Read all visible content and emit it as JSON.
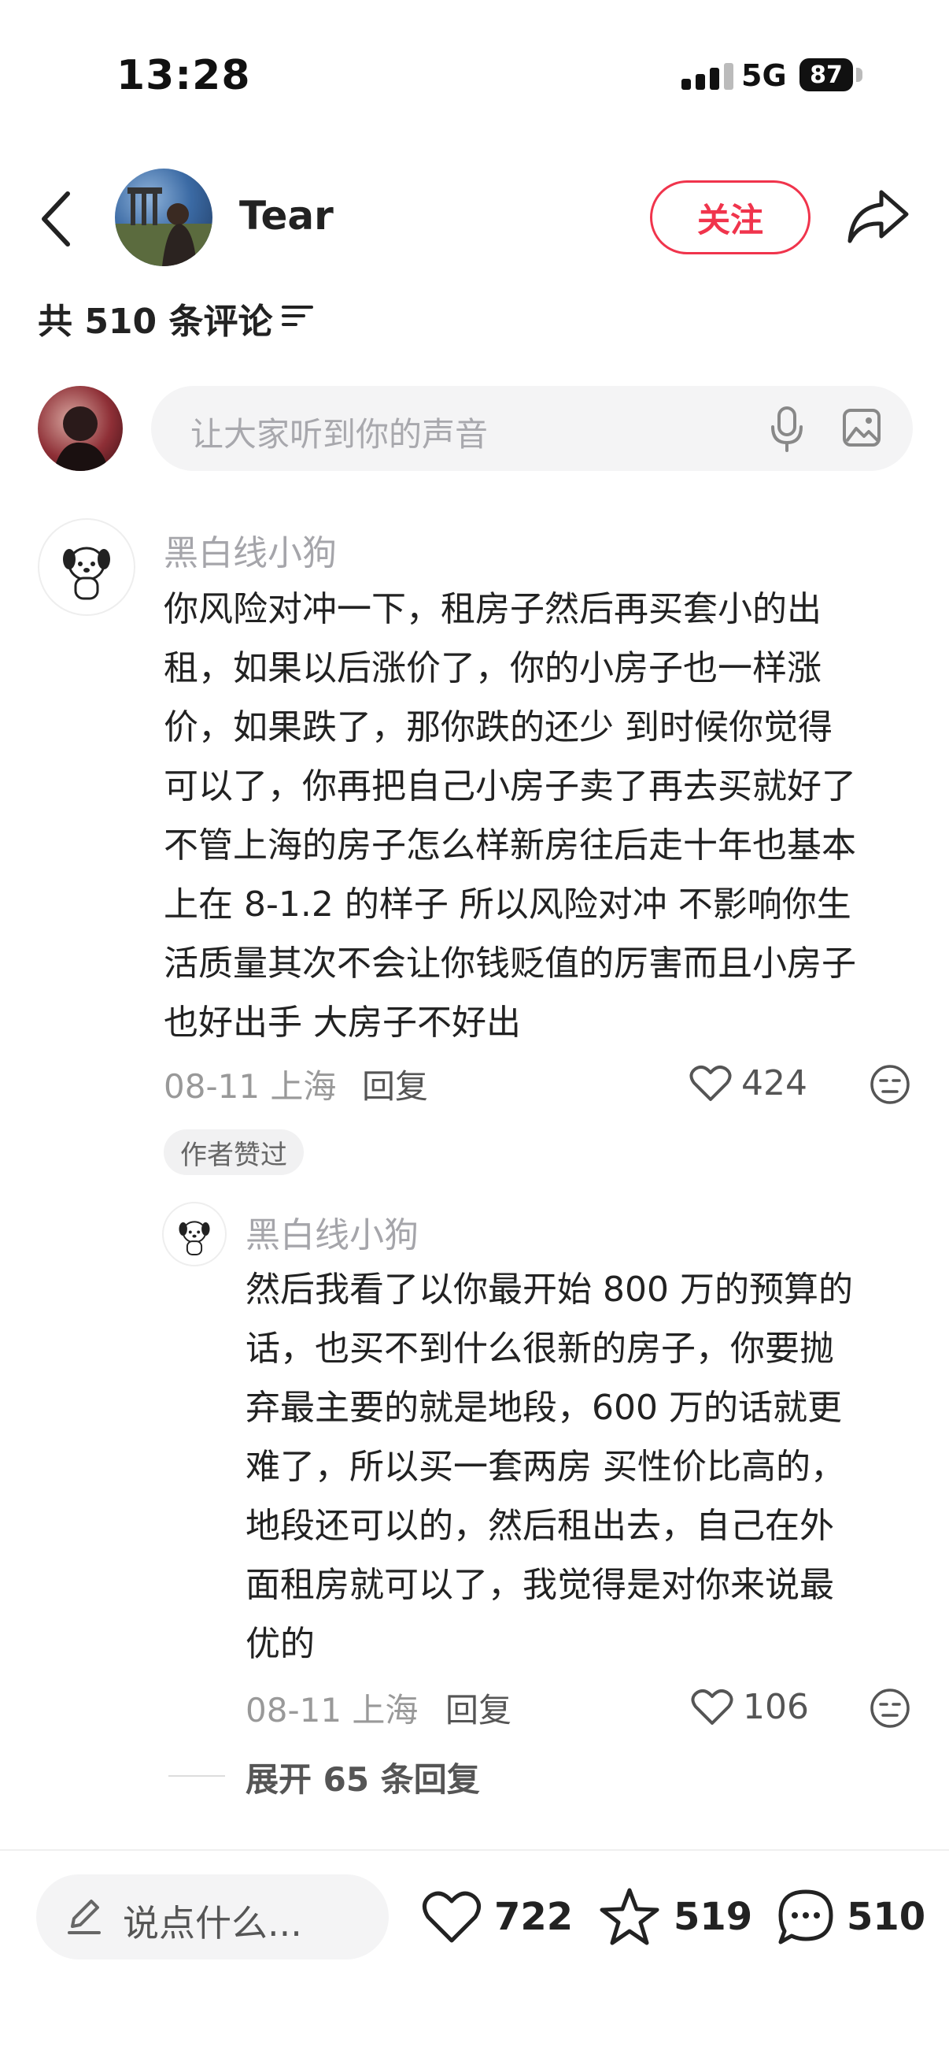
{
  "status": {
    "time": "13:28",
    "network": "5G",
    "battery": "87"
  },
  "header": {
    "back_icon": "chevron-left-icon",
    "author_name": "Tear",
    "follow_label": "关注",
    "share_icon": "share-arrow-icon"
  },
  "comments_header": {
    "count_text": "共 510 条评论",
    "sort_icon": "sort-lines-icon"
  },
  "input": {
    "placeholder": "让大家听到你的声音",
    "mic_icon": "microphone-icon",
    "image_icon": "image-icon"
  },
  "comment": {
    "user": "黑白线小狗",
    "lines": [
      "你风险对冲一下，租房子然后再买套小的出",
      "租，如果以后涨价了，你的小房子也一样涨",
      "价，如果跌了，那你跌的还少 到时候你觉得",
      "可以了，你再把自己小房子卖了再去买就好了",
      "不管上海的房子怎么样新房往后走十年也基本",
      "上在 8-1.2 的样子 所以风险对冲 不影响你生",
      "活质量其次不会让你钱贬值的厉害而且小房子",
      "也好出手 大房子不好出"
    ],
    "date_location": "08-11 上海",
    "reply_label": "回复",
    "likes": "424",
    "author_badge": "作者赞过"
  },
  "reply": {
    "user": "黑白线小狗",
    "lines": [
      "然后我看了以你最开始 800 万的预算的",
      "话，也买不到什么很新的房子，你要抛",
      "弃最主要的就是地段，600 万的话就更",
      "难了，所以买一套两房 买性价比高的，",
      "地段还可以的，然后租出去，自己在外",
      "面租房就可以了，我觉得是对你来说最",
      "优的"
    ],
    "date_location": "08-11 上海",
    "reply_label": "回复",
    "likes": "106"
  },
  "expand_label": "展开 65 条回复",
  "bottom": {
    "say_placeholder": "说点什么...",
    "likes": "722",
    "stars": "519",
    "comments": "510"
  },
  "colors": {
    "accent": "#f0344c",
    "muted": "#a5a5aa",
    "bg": "#ffffff"
  }
}
